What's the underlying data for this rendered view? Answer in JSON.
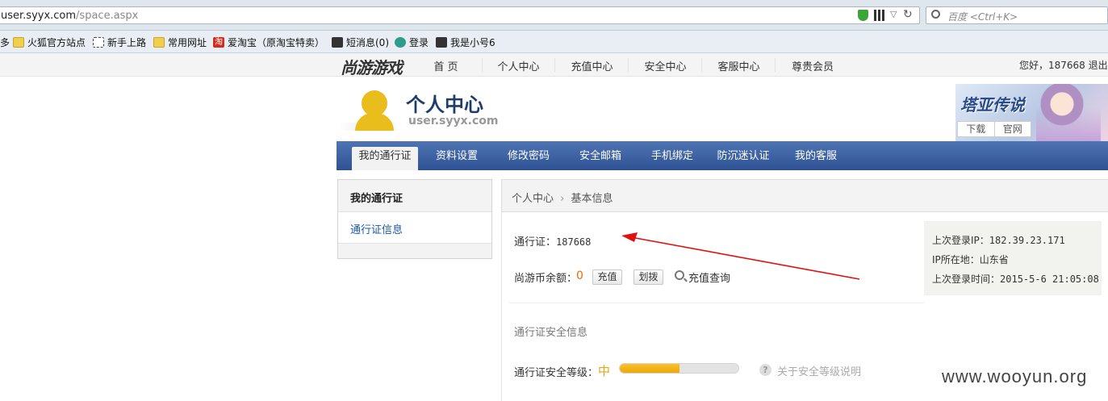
{
  "browser": {
    "url_domain": "user.syyx.com",
    "url_path": "/space.aspx",
    "search_placeholder": "百度 <Ctrl+K>",
    "bookmarks": [
      {
        "label": "多",
        "icon": "none"
      },
      {
        "label": "火狐官方站点",
        "icon": "folder-icon"
      },
      {
        "label": "新手上路",
        "icon": "page-icon"
      },
      {
        "label": "常用网址",
        "icon": "folder-icon"
      },
      {
        "label": "爱淘宝（原淘宝特卖）",
        "icon": "taobao-icon"
      },
      {
        "label": "短消息(0)",
        "icon": "game-icon"
      },
      {
        "label": "登录",
        "icon": "login-icon"
      },
      {
        "label": "我是小号6",
        "icon": "game-icon"
      }
    ]
  },
  "site": {
    "logo": "尚游游戏",
    "nav": [
      "首 页",
      "个人中心",
      "充值中心",
      "安全中心",
      "客服中心",
      "尊贵会员"
    ],
    "greeting": "您好，187668  退出"
  },
  "header": {
    "title": "个人中心",
    "domain": "user.syyx.com",
    "banner_game": "塔亚传说",
    "banner_links": [
      "下载",
      "官网"
    ]
  },
  "tabs": [
    "我的通行证",
    "资料设置",
    "修改密码",
    "安全邮箱",
    "手机绑定",
    "防沉迷认证",
    "我的客服"
  ],
  "sidebar": {
    "heading": "我的通行证",
    "link": "通行证信息"
  },
  "main": {
    "breadcrumb": [
      "个人中心",
      "基本信息"
    ],
    "pass_label": "通行证：",
    "pass_value": "187668",
    "balance_label": "尚游币余额：",
    "balance_value": "0",
    "recharge_button": "充值",
    "transfer_button": "划拨",
    "query_link": "充值查询",
    "security_section": "通行证安全信息",
    "security_level_label": "通行证安全等级：",
    "security_level_value": "中",
    "security_level_fraction": 0.5,
    "security_help": "关于安全等级说明",
    "last_login_ip_label": "上次登录IP：",
    "last_login_ip": "182.39.23.171",
    "ip_location_label": "IP所在地：",
    "ip_location": "山东省",
    "last_login_time_label": "上次登录时间：",
    "last_login_time": "2015-5-6 21:05:08"
  },
  "watermark": "www.wooyun.org",
  "colors": {
    "tab_bar": "#2e5293",
    "link": "#1a58a8",
    "balance": "#e76c11",
    "level": "#e8a515",
    "annotation_arrow": "#e01010"
  }
}
